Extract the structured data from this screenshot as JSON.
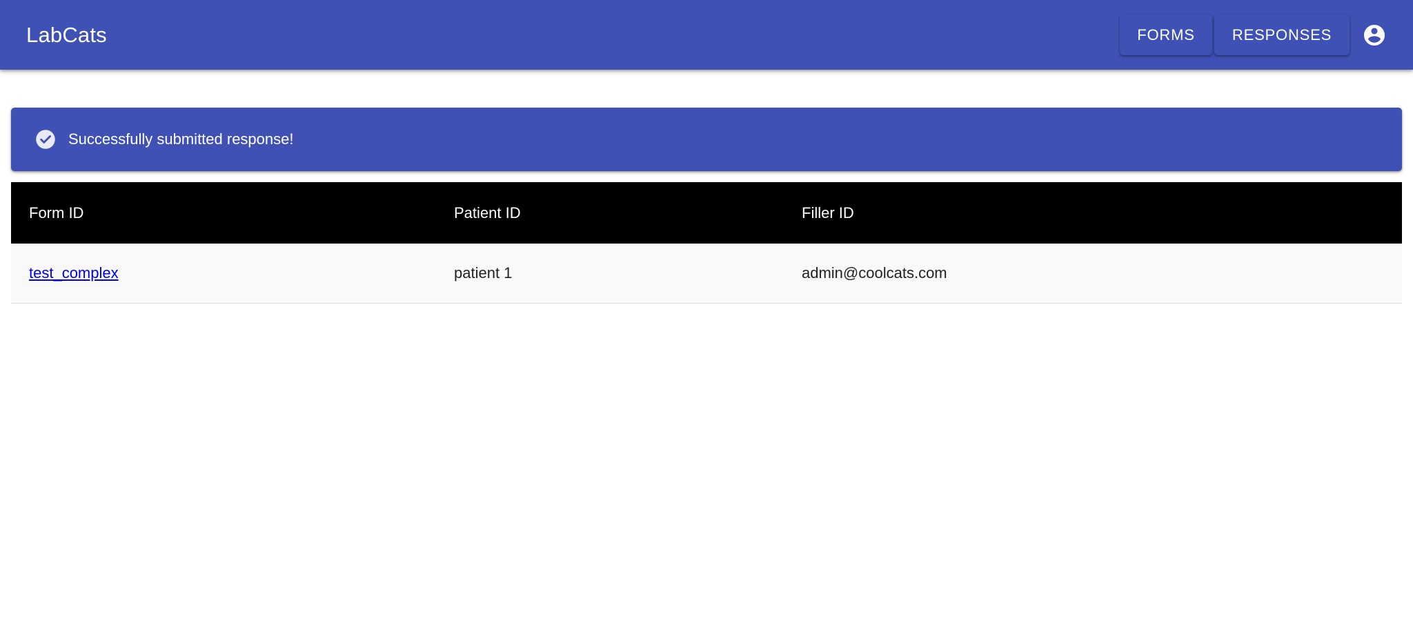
{
  "app": {
    "brand": "LabCats"
  },
  "nav": {
    "forms_label": "FORMS",
    "responses_label": "RESPONSES",
    "account_icon": "account-circle-icon"
  },
  "alert": {
    "icon": "check-circle-icon",
    "message": "Successfully submitted response!"
  },
  "table": {
    "columns": [
      "Form ID",
      "Patient ID",
      "Filler ID"
    ],
    "rows": [
      [
        "test_complex",
        "patient 1",
        "admin@coolcats.com"
      ]
    ]
  },
  "colors": {
    "primary": "#3f51b5",
    "header_bg": "#000000",
    "row_bg": "#f9f9f9",
    "link": "#0000ee"
  }
}
